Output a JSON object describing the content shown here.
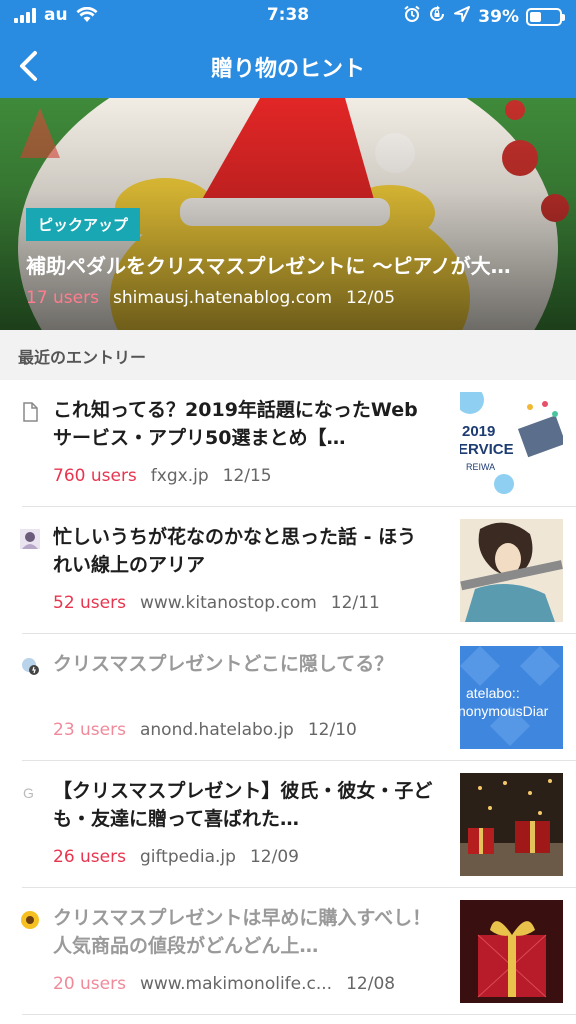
{
  "status_bar": {
    "carrier": "au",
    "time": "7:38",
    "battery": "39%",
    "battery_level": 0.39,
    "icons": [
      "signal-icon",
      "wifi-icon",
      "alarm-icon",
      "rotation-lock-icon",
      "location-icon",
      "battery-icon"
    ]
  },
  "nav": {
    "title": "贈り物のヒント",
    "back_icon": "chevron-left-icon"
  },
  "colors": {
    "header": "#2a8ce0",
    "pickup_tag": "#19a7b4",
    "users": "#e8354f"
  },
  "hero": {
    "tag": "ピックアップ",
    "title": "補助ペダルをクリスマスプレゼントに 〜ピアノが大…",
    "users": "17 users",
    "domain": "shimausj.hatenablog.com",
    "date": "12/05"
  },
  "section": {
    "title": "最近のエントリー"
  },
  "entries": [
    {
      "title": "これ知ってる？2019年話題になったWebサービス・アプリ50選まとめ【…",
      "users": "760 users",
      "domain": "fxgx.jp",
      "date": "12/15",
      "favicon": "document-icon",
      "thumb_text": [
        "2019",
        "ERVICE",
        "REIWA"
      ]
    },
    {
      "title": "忙しいうちが花なのかなと思った話 - ほうれい線上のアリア",
      "users": "52 users",
      "domain": "www.kitanostop.com",
      "date": "12/11",
      "favicon": "avatar-icon"
    },
    {
      "title": "クリスマスプレゼントどこに隠してる？",
      "users": "23 users",
      "domain": "anond.hatelabo.jp",
      "date": "12/10",
      "favicon": "anonymous-diary-icon",
      "thumb_text": [
        "atelabo::",
        "nonymousDiar"
      ]
    },
    {
      "title": "【クリスマスプレゼント】彼氏・彼女・子ども・友達に贈って喜ばれた…",
      "users": "26 users",
      "domain": "giftpedia.jp",
      "date": "12/09",
      "favicon": "g-letter-icon",
      "favicon_text": "G"
    },
    {
      "title": "クリスマスプレゼントは早めに購入すべし！人気商品の値段がどんどん上…",
      "users": "20 users",
      "domain": "www.makimonolife.c...",
      "date": "12/08",
      "favicon": "sunflower-icon"
    }
  ]
}
